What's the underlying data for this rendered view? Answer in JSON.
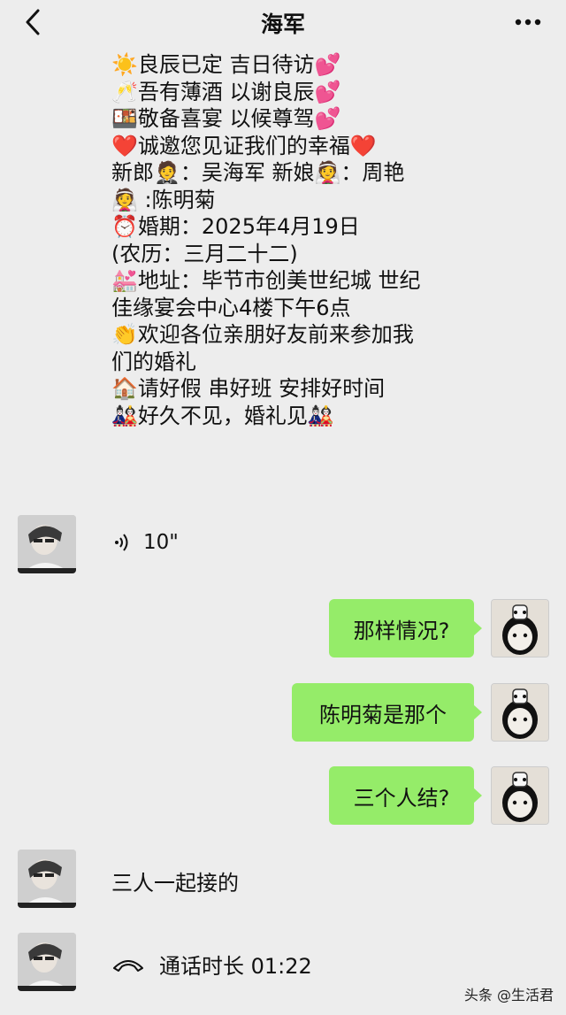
{
  "header": {
    "title": "海军",
    "back_icon": "chevron-left-icon",
    "more_icon": "ellipsis-icon"
  },
  "invitation": {
    "lines": [
      {
        "emoji": "☀️",
        "text": "良辰已定 吉日待访",
        "emoji_after": "💕"
      },
      {
        "emoji": "🥂",
        "text": "吾有薄酒 以谢良辰",
        "emoji_after": "💕"
      },
      {
        "emoji": "🍱",
        "text": "敬备喜宴 以候尊驾",
        "emoji_after": "💕"
      },
      {
        "emoji": "❤️",
        "text": "诚邀您见证我们的幸福",
        "emoji_after": "❤️"
      },
      {
        "emoji": "",
        "text": "新郎🤵：吴海军  新娘👰：周艳",
        "emoji_after": ""
      },
      {
        "emoji": "👰",
        "text": " :陈明菊",
        "emoji_after": ""
      },
      {
        "emoji": "⏰",
        "text": "婚期：2025年4月19日",
        "emoji_after": ""
      },
      {
        "emoji": "",
        "text": "(农历：三月二十二)",
        "emoji_after": ""
      },
      {
        "emoji": "💒",
        "text": "地址：毕节市创美世纪城  世纪",
        "emoji_after": ""
      },
      {
        "emoji": "",
        "text": "佳缘宴会中心4楼下午6点",
        "emoji_after": ""
      },
      {
        "emoji": "👏",
        "text": "欢迎各位亲朋好友前来参加我",
        "emoji_after": ""
      },
      {
        "emoji": "",
        "text": "们的婚礼",
        "emoji_after": ""
      },
      {
        "emoji": "🏠",
        "text": "请好假 串好班 安排好时间",
        "emoji_after": ""
      },
      {
        "emoji": "🎎",
        "text": "好久不见，婚礼见",
        "emoji_after": "🎎"
      }
    ]
  },
  "messages": {
    "voice": {
      "duration": "10\"",
      "icon": "voice-wave-icon"
    },
    "out1": "那样情况?",
    "out2": "陈明菊是那个",
    "out3": "三个人结?",
    "in1": "三人一起接的",
    "call": {
      "label": "通话时长 01:22",
      "icon": "phone-hangup-icon"
    }
  },
  "watermark": "头条 @生活君",
  "colors": {
    "background": "#ededed",
    "outgoing_bubble": "#95ec69"
  }
}
